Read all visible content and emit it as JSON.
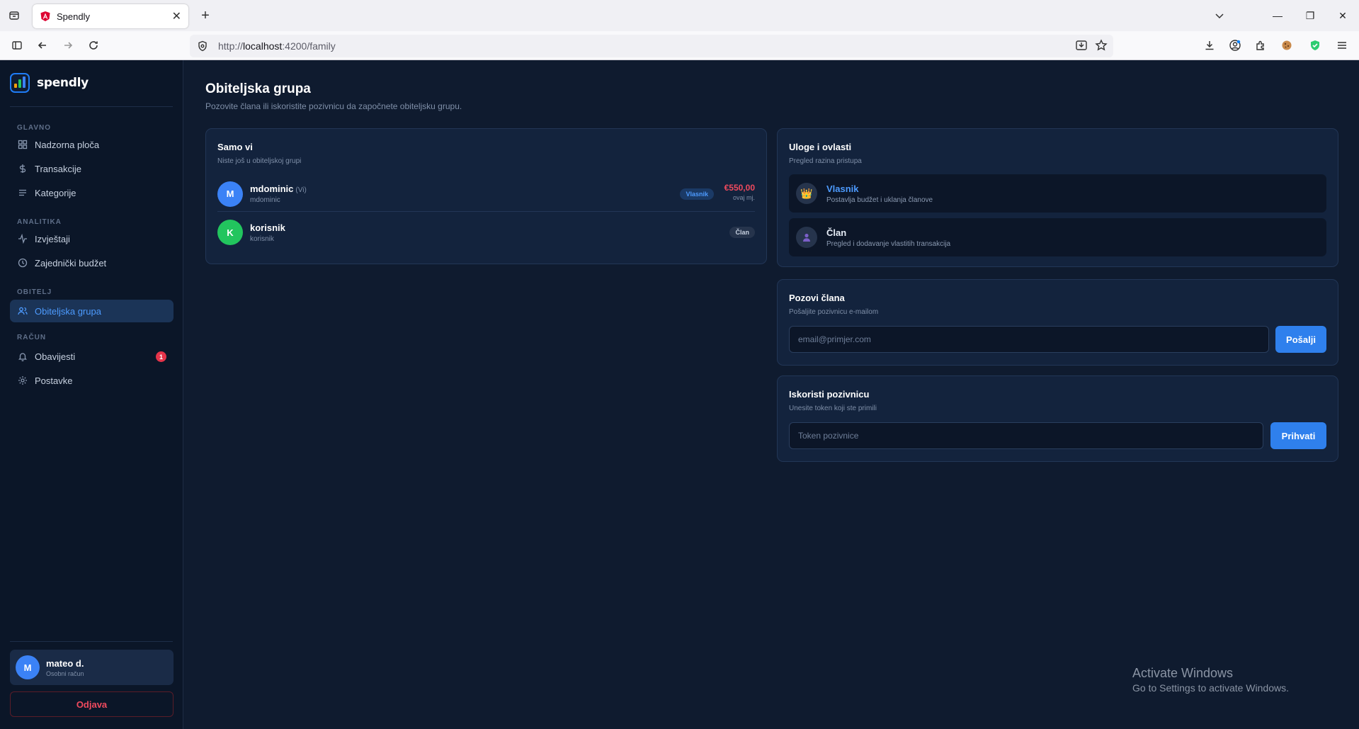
{
  "browser": {
    "tab_title": "Spendly",
    "url_prefix": "http://",
    "url_host": "localhost",
    "url_path": ":4200/family"
  },
  "sidebar": {
    "brand": "spendly",
    "sections": {
      "main": "GLAVNO",
      "analytics": "ANALITIKA",
      "family": "OBITELJ",
      "account": "RAČUN"
    },
    "items": [
      {
        "label": "Nadzorna ploča",
        "icon": "grid-icon"
      },
      {
        "label": "Transakcije",
        "icon": "dollar-icon"
      },
      {
        "label": "Kategorije",
        "icon": "list-icon"
      },
      {
        "label": "Izvještaji",
        "icon": "activity-icon"
      },
      {
        "label": "Zajednički budžet",
        "icon": "clock-icon"
      },
      {
        "label": "Obiteljska grupa",
        "icon": "users-icon",
        "active": true
      },
      {
        "label": "Obavijesti",
        "icon": "bell-icon",
        "badge": "1"
      },
      {
        "label": "Postavke",
        "icon": "gear-icon"
      }
    ],
    "user": {
      "initial": "M",
      "name": "mateo d.",
      "type": "Osobni račun"
    },
    "logout": "Odjava"
  },
  "page": {
    "title": "Obiteljska grupa",
    "subtitle": "Pozovite člana ili iskoristite pozivnicu da započnete obiteljsku grupu."
  },
  "members_card": {
    "title": "Samo vi",
    "subtitle": "Niste još u obiteljskoj grupi",
    "members": [
      {
        "initial": "M",
        "name": "mdominic",
        "you": "(Vi)",
        "username": "mdominic",
        "role": "Vlasnik",
        "amount": "€550,00",
        "period": "ovaj mj.",
        "color": "#3b82f6"
      },
      {
        "initial": "K",
        "name": "korisnik",
        "username": "korisnik",
        "role": "Član",
        "color": "#22c55e"
      }
    ]
  },
  "roles_card": {
    "title": "Uloge i ovlasti",
    "subtitle": "Pregled razina pristupa",
    "roles": [
      {
        "name": "Vlasnik",
        "desc": "Postavlja budžet i uklanja članove",
        "color": "#4d9bff",
        "icon": "crown-icon"
      },
      {
        "name": "Član",
        "desc": "Pregled i dodavanje vlastitih transakcija",
        "color": "#e6edf7",
        "icon": "person-icon"
      }
    ]
  },
  "invite_card": {
    "title": "Pozovi člana",
    "subtitle": "Pošaljite pozivnicu e-mailom",
    "placeholder": "email@primjer.com",
    "button": "Pošalji"
  },
  "redeem_card": {
    "title": "Iskoristi pozivnicu",
    "subtitle": "Unesite token koji ste primili",
    "placeholder": "Token pozivnice",
    "button": "Prihvati"
  },
  "watermark": {
    "line1": "Activate Windows",
    "line2": "Go to Settings to activate Windows."
  }
}
